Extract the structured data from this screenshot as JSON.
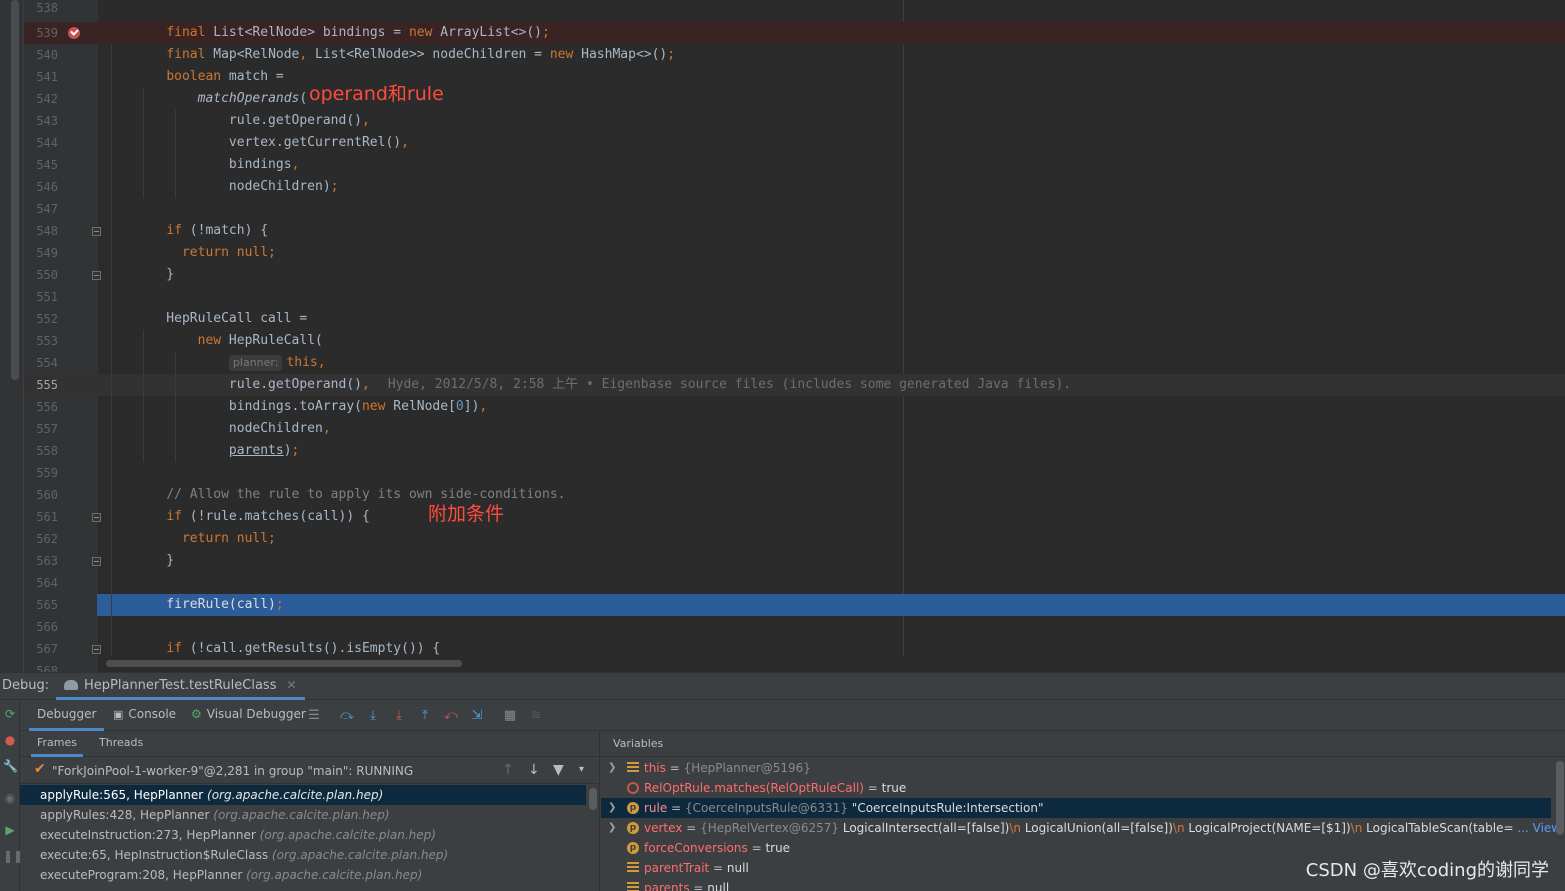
{
  "editor": {
    "lines": [
      {
        "ln": "538",
        "html": ""
      },
      {
        "ln": "539",
        "html": "    <span class=\"kw\">final</span> List&lt;RelNode&gt; bindings = <span class=\"kw\">new</span> ArrayList&lt;&gt;()<span class=\"kw\">;</span>",
        "bp": true
      },
      {
        "ln": "540",
        "html": "    <span class=\"kw\">final</span> Map&lt;RelNode<span class=\"kw\">,</span> List&lt;RelNode&gt;&gt; nodeChildren = <span class=\"kw\">new</span> HashMap&lt;&gt;()<span class=\"kw\">;</span>"
      },
      {
        "ln": "541",
        "html": "    <span class=\"kw\">boolean</span> match ="
      },
      {
        "ln": "542",
        "html": "        <span class=\"fn\">matchOperands</span>("
      },
      {
        "ln": "543",
        "html": "            rule.getOperand()<span class=\"kw\">,</span>"
      },
      {
        "ln": "544",
        "html": "            vertex.getCurrentRel()<span class=\"kw\">,</span>"
      },
      {
        "ln": "545",
        "html": "            bindings<span class=\"kw\">,</span>"
      },
      {
        "ln": "546",
        "html": "            nodeChildren)<span class=\"kw\">;</span>"
      },
      {
        "ln": "547",
        "html": ""
      },
      {
        "ln": "548",
        "html": "    <span class=\"kw\">if</span> (!match) {",
        "fold": true
      },
      {
        "ln": "549",
        "html": "      <span class=\"kw\">return null;</span>"
      },
      {
        "ln": "550",
        "html": "    }",
        "fold": true
      },
      {
        "ln": "551",
        "html": ""
      },
      {
        "ln": "552",
        "html": "    HepRuleCall call ="
      },
      {
        "ln": "553",
        "html": "        <span class=\"kw\">new</span> HepRuleCall("
      },
      {
        "ln": "554",
        "html": "            <span class=\"hint\">planner:</span><span class=\"kw\">this,</span>"
      },
      {
        "ln": "555",
        "html": "            rule.getOperand()<span class=\"kw\">,</span><span class=\"blame\">Hyde, 2012/5/8, 2:58 上午 • Eigenbase source files (includes some generated Java files).</span>",
        "cur": true
      },
      {
        "ln": "556",
        "html": "            bindings.toArray(<span class=\"kw\">new</span> RelNode[<span class=\"num\">0</span>])<span class=\"kw\">,</span>"
      },
      {
        "ln": "557",
        "html": "            nodeChildren<span class=\"kw\">,</span>"
      },
      {
        "ln": "558",
        "html": "            <span class=\"ul\">parents</span>)<span class=\"kw\">;</span>"
      },
      {
        "ln": "559",
        "html": ""
      },
      {
        "ln": "560",
        "html": "    <span class=\"cmt\">// Allow the rule to apply its own side-conditions.</span>"
      },
      {
        "ln": "561",
        "html": "    <span class=\"kw\">if</span> (!rule.matches(call)) {",
        "fold": true
      },
      {
        "ln": "562",
        "html": "      <span class=\"kw\">return null;</span>"
      },
      {
        "ln": "563",
        "html": "    }",
        "fold": true
      },
      {
        "ln": "564",
        "html": ""
      },
      {
        "ln": "565",
        "html": "    fireRule(call)<span class=\"kw\">;</span>",
        "exec": true
      },
      {
        "ln": "566",
        "html": ""
      },
      {
        "ln": "567",
        "html": "    <span class=\"kw\">if</span> (!call.getResults().isEmpty()) {",
        "fold": true
      },
      {
        "ln": "568",
        "html": ""
      }
    ],
    "annotations": {
      "operand_rule": "operand和rule",
      "extra_condition": "附加条件"
    }
  },
  "debug": {
    "label": "Debug:",
    "session_tab": "HepPlannerTest.testRuleClass",
    "tabs": {
      "debugger": "Debugger",
      "console": "Console",
      "visual_debugger": "Visual Debugger"
    },
    "frames_tab": "Frames",
    "threads_tab": "Threads",
    "thread": "\"ForkJoinPool-1-worker-9\"@2,281 in group \"main\": RUNNING",
    "frames": [
      {
        "method": "applyRule:565, HepPlanner",
        "pkg": "(org.apache.calcite.plan.hep)",
        "selected": true
      },
      {
        "method": "applyRules:428, HepPlanner",
        "pkg": "(org.apache.calcite.plan.hep)"
      },
      {
        "method": "executeInstruction:273, HepPlanner",
        "pkg": "(org.apache.calcite.plan.hep)"
      },
      {
        "method": "execute:65, HepInstruction$RuleClass",
        "pkg": "(org.apache.calcite.plan.hep)"
      },
      {
        "method": "executeProgram:208, HepPlanner",
        "pkg": "(org.apache.calcite.plan.hep)"
      }
    ],
    "variables_title": "Variables",
    "variables": [
      {
        "icon": "field",
        "expandable": true,
        "name": "this",
        "ref": "{HepPlanner@5196}",
        "value": ""
      },
      {
        "icon": "watch",
        "expandable": false,
        "name": "RelOptRule.matches(RelOptRuleCall)",
        "ref": "",
        "value": "true"
      },
      {
        "icon": "p",
        "expandable": true,
        "name": "rule",
        "ref": "{CoerceInputsRule@6331}",
        "value": "\"CoerceInputsRule:Intersection\"",
        "selected": true
      },
      {
        "icon": "p",
        "expandable": true,
        "name": "vertex",
        "ref": "{HepRelVertex@6257}",
        "value": "LogicalIntersect(all=[false])\\n  LogicalUnion(all=[false])\\n    LogicalProject(NAME=[$1])\\n      LogicalTableScan(table=",
        "link": "View"
      },
      {
        "icon": "p",
        "expandable": false,
        "name": "forceConversions",
        "ref": "",
        "value": "true"
      },
      {
        "icon": "field",
        "expandable": false,
        "name": "parentTrait",
        "ref": "",
        "value": "null"
      },
      {
        "icon": "field",
        "expandable": false,
        "name": "parents",
        "ref": "",
        "value": "null"
      }
    ]
  },
  "watermark": "CSDN @喜欢coding的谢同学",
  "colors": {
    "exec_line": "#2d5c9b",
    "breakpoint": "#c75450",
    "keyword": "#cc7832",
    "annotation": "#ff4b3e",
    "selection": "#0d293e"
  }
}
